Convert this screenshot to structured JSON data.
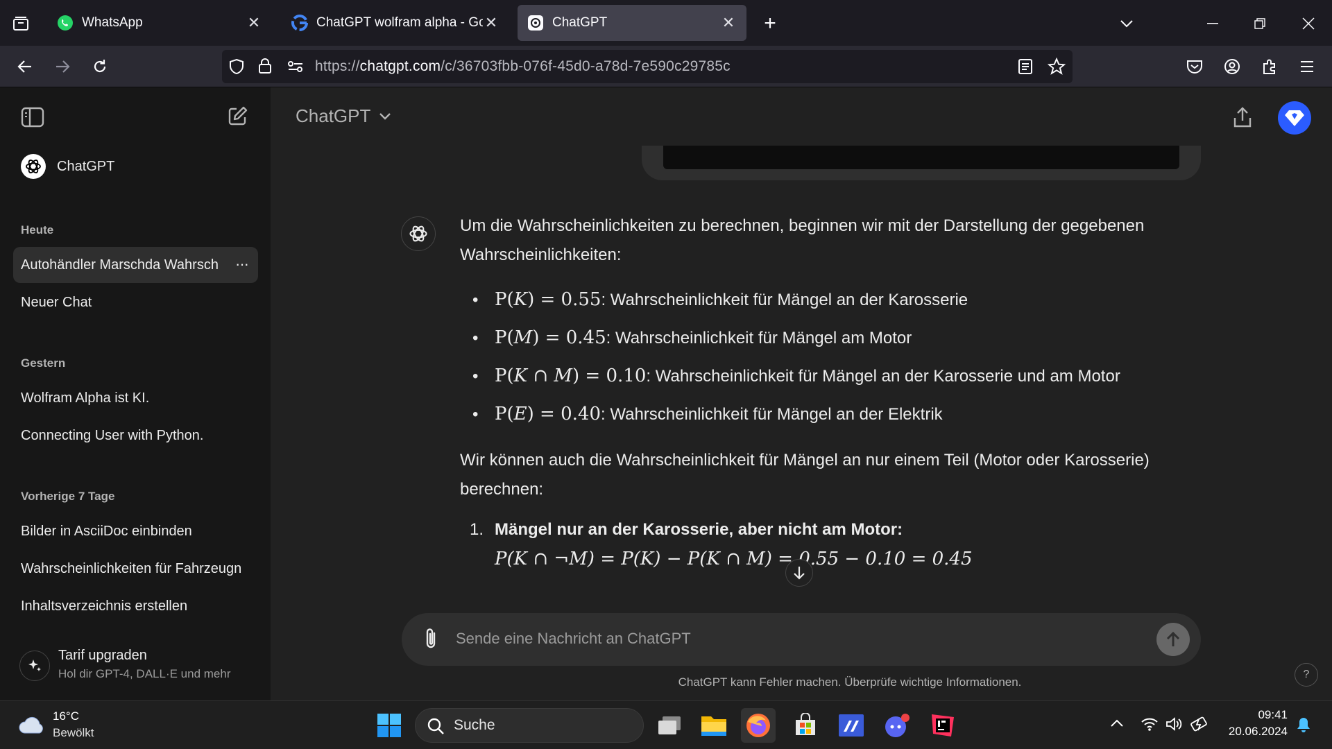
{
  "browser": {
    "tabs": [
      {
        "title": "WhatsApp"
      },
      {
        "title": "ChatGPT wolfram alpha - Googl"
      },
      {
        "title": "ChatGPT"
      }
    ],
    "url_prefix": "https://",
    "url_host": "chatgpt.com",
    "url_path": "/c/36703fbb-076f-45d0-a78d-7e590c29785c"
  },
  "sidebar": {
    "brand": "ChatGPT",
    "groups": [
      {
        "heading": "Heute",
        "items": [
          "Autohändler Marschda Wahrsch",
          "Neuer Chat"
        ]
      },
      {
        "heading": "Gestern",
        "items": [
          "Wolfram Alpha ist KI.",
          "Connecting User with Python."
        ]
      },
      {
        "heading": "Vorherige 7 Tage",
        "items": [
          "Bilder in AsciiDoc einbinden",
          "Wahrscheinlichkeiten für Fahrzeugn",
          "Inhaltsverzeichnis erstellen"
        ]
      }
    ],
    "upgrade": {
      "title": "Tarif upgraden",
      "subtitle": "Hol dir GPT-4, DALL·E und mehr"
    },
    "more_glyph": "···"
  },
  "header": {
    "model": "ChatGPT"
  },
  "message": {
    "intro": "Um die Wahrscheinlichkeiten zu berechnen, beginnen wir mit der Darstellung der gegebenen Wahrscheinlichkeiten:",
    "bullets": [
      {
        "math_func": "P(",
        "math_var": "K",
        "math_close": ")",
        "math_eq": " = 0.55",
        "text": ": Wahrscheinlichkeit für Mängel an der Karosserie"
      },
      {
        "math_func": "P(",
        "math_var": "M",
        "math_close": ")",
        "math_eq": " = 0.45",
        "text": ": Wahrscheinlichkeit für Mängel am Motor"
      },
      {
        "math_func": "P(",
        "math_var": "K ∩ M",
        "math_close": ")",
        "math_eq": " = 0.10",
        "text": ": Wahrscheinlichkeit für Mängel an der Karosserie und am Motor"
      },
      {
        "math_func": "P(",
        "math_var": "E",
        "math_close": ")",
        "math_eq": " = 0.40",
        "text": ": Wahrscheinlichkeit für Mängel an der Elektrik"
      }
    ],
    "para2": "Wir können auch die Wahrscheinlichkeit für Mängel an nur einem Teil (Motor oder Karosserie) berechnen:",
    "item1_num": "1.",
    "item1_title": "Mängel nur an der Karosserie, aber nicht am Motor:",
    "item1_formula": "P(K ∩ ¬M) = P(K) − P(K ∩ M) = 0.55 − 0.10 = 0.45"
  },
  "composer": {
    "placeholder": "Sende eine Nachricht an ChatGPT"
  },
  "disclaimer": "ChatGPT kann Fehler machen. Überprüfe wichtige Informationen.",
  "help": "?",
  "taskbar": {
    "weather_temp": "16°C",
    "weather_desc": "Bewölkt",
    "search_label": "Suche",
    "time": "09:41",
    "date": "20.06.2024"
  },
  "colors": {
    "accent": "#2b5cff",
    "sidebar": "#171717",
    "main": "#212121"
  }
}
